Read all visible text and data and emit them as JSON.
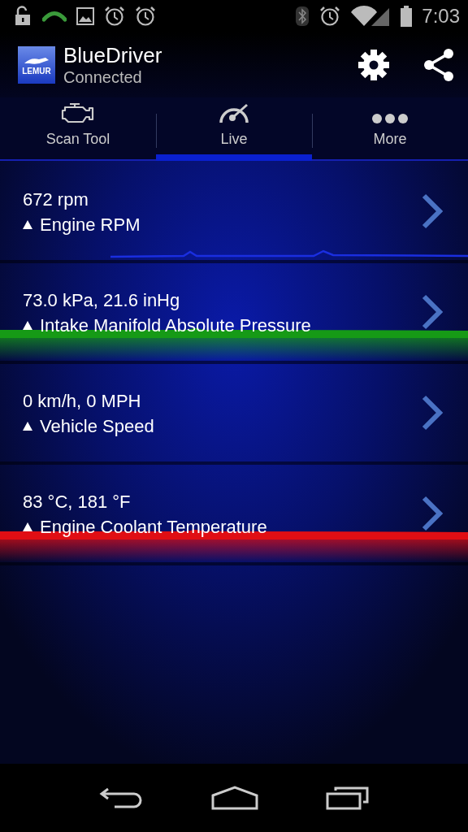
{
  "status_bar": {
    "time": "7:03"
  },
  "app_bar": {
    "title": "BlueDriver",
    "subtitle": "Connected",
    "logo_text": "LEMUR"
  },
  "tabs": [
    {
      "label": "Scan Tool",
      "selected": false
    },
    {
      "label": "Live",
      "selected": true
    },
    {
      "label": "More",
      "selected": false
    }
  ],
  "readings": [
    {
      "value": "672 rpm",
      "name": "Engine RPM",
      "graph": {
        "kind": "line",
        "color": "#1a2ee0"
      }
    },
    {
      "value": "73.0 kPa, 21.6 inHg",
      "name": "Intake Manifold Absolute Pressure",
      "graph": {
        "kind": "band",
        "color": "#169a16"
      }
    },
    {
      "value": "0 km/h, 0 MPH",
      "name": "Vehicle Speed"
    },
    {
      "value": "83 °C, 181 °F",
      "name": "Engine Coolant Temperature",
      "graph": {
        "kind": "band",
        "color": "#e00e14"
      }
    }
  ]
}
